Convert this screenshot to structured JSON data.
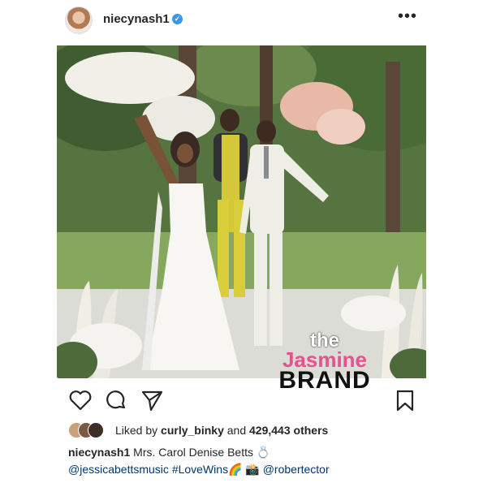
{
  "header": {
    "username": "niecynash1",
    "verified_symbol": "✓",
    "more_symbol": "•••"
  },
  "watermark": {
    "line1": "the",
    "line2": "Jasmine",
    "line3": "BRAND"
  },
  "actions": {
    "icons": [
      "heart-icon",
      "comment-icon",
      "share-icon",
      "bookmark-icon"
    ]
  },
  "likes": {
    "prefix": "Liked by ",
    "first_liker": "curly_binky",
    "middle": " and ",
    "count": "429,443 others"
  },
  "caption": {
    "username": "niecynash1",
    "text": " Mrs. Carol Denise Betts 💍",
    "mention1": "@jessicabettsmusic",
    "hashtag": "#LoveWins🌈",
    "camera": "📸",
    "mention2": "@robertector"
  }
}
